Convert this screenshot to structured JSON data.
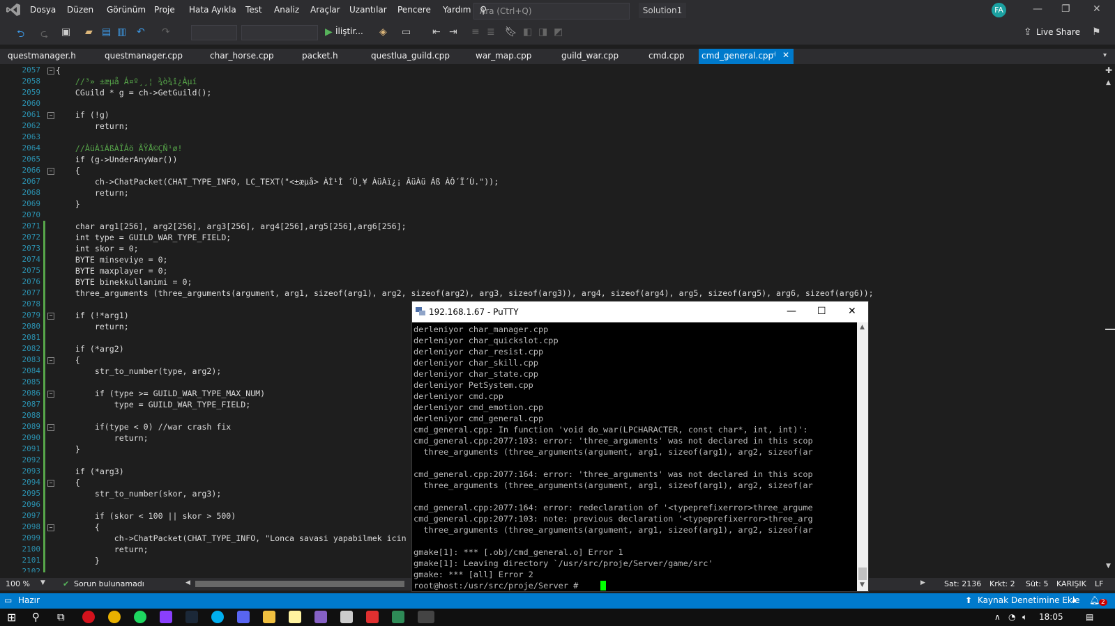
{
  "colors": {
    "accent": "#007acc",
    "editor_bg": "#1e1e1e",
    "chrome_bg": "#2d2d30"
  },
  "menu": [
    "Dosya",
    "Düzen",
    "Görünüm",
    "Proje",
    "Hata Ayıkla",
    "Test",
    "Analiz",
    "Araçlar",
    "Uzantılar",
    "Pencere",
    "Yardım"
  ],
  "search": {
    "placeholder": "Ara (Ctrl+Q)"
  },
  "solution_name": "Solution1",
  "user_initials": "FA",
  "toolbar": {
    "run_label": "İliştir...",
    "live_share": "Live Share"
  },
  "tabs": [
    "questmanager.h",
    "questmanager.cpp",
    "char_horse.cpp",
    "packet.h",
    "questlua_guild.cpp",
    "war_map.cpp",
    "guild_war.cpp",
    "cmd.cpp"
  ],
  "active_tab": "cmd_general.cpp",
  "editor": {
    "line_numbers": [
      "2057",
      "2058",
      "2059",
      "2060",
      "2061",
      "2062",
      "2063",
      "2064",
      "2065",
      "2066",
      "2067",
      "2068",
      "2069",
      "2070",
      "2071",
      "2072",
      "2073",
      "2074",
      "2075",
      "2076",
      "2077",
      "2078",
      "2079",
      "2080",
      "2081",
      "2082",
      "2083",
      "2084",
      "2085",
      "2086",
      "2087",
      "2088",
      "2089",
      "2090",
      "2091",
      "2092",
      "2093",
      "2094",
      "2095",
      "2096",
      "2097",
      "2098",
      "2099",
      "2100",
      "2101",
      "2102"
    ],
    "lines": [
      "{",
      "    //³» ±æµå Á¤º¸¸¦ ¾ò¾î¿Àµí",
      "    CGuild * g = ch->GetGuild();",
      "",
      "    if (!g)",
      "        return;",
      "",
      "    //ÀüÀïÁßÀÎÁö ÃŸÅ©ÇÑ¹ø!",
      "    if (g->UnderAnyWar())",
      "    {",
      "        ch->ChatPacket(CHAT_TYPE_INFO, LC_TEXT(\"<±æµå> ÀÌ¹Ì ´Ù¸¥ ÀüÀï¿¡ ÂüÀü Áß ÀÔ´Ï´Ù.\"));",
      "        return;",
      "    }",
      "",
      "    char arg1[256], arg2[256], arg3[256], arg4[256],arg5[256],arg6[256];",
      "    int type = GUILD_WAR_TYPE_FIELD;",
      "    int skor = 0;",
      "    BYTE minseviye = 0;",
      "    BYTE maxplayer = 0;",
      "    BYTE binekkullanimi = 0;",
      "    three_arguments (three_arguments(argument, arg1, sizeof(arg1), arg2, sizeof(arg2), arg3, sizeof(arg3)), arg4, sizeof(arg4), arg5, sizeof(arg5), arg6, sizeof(arg6));",
      "",
      "    if (!*arg1)",
      "        return;",
      "",
      "    if (*arg2)",
      "    {",
      "        str_to_number(type, arg2);",
      "",
      "        if (type >= GUILD_WAR_TYPE_MAX_NUM)",
      "            type = GUILD_WAR_TYPE_FIELD;",
      "",
      "        if(type < 0) //war crash fix",
      "            return;",
      "    }",
      "",
      "    if (*arg3)",
      "    {",
      "        str_to_number(skor, arg3);",
      "",
      "        if (skor < 100 || skor > 500)",
      "        {",
      "            ch->ChatPacket(CHAT_TYPE_INFO, \"Lonca savasi yapabilmek icin",
      "            return;",
      "        }",
      ""
    ]
  },
  "editor_status": {
    "zoom": "100 %",
    "issues": "Sorun bulunamadı",
    "line": "Sat: 2136",
    "char": "Krkt: 2",
    "col": "Süt: 5",
    "mode": "KARIŞIK",
    "eol": "LF"
  },
  "statusbar": {
    "ready": "Hazır",
    "source_control": "Kaynak Denetimine Ekle",
    "notifications": "2"
  },
  "clock": "18:05",
  "putty": {
    "title": "192.168.1.67 - PuTTY",
    "lines": [
      "derleniyor char_manager.cpp",
      "derleniyor char_quickslot.cpp",
      "derleniyor char_resist.cpp",
      "derleniyor char_skill.cpp",
      "derleniyor char_state.cpp",
      "derleniyor PetSystem.cpp",
      "derleniyor cmd.cpp",
      "derleniyor cmd_emotion.cpp",
      "derleniyor cmd_general.cpp",
      "cmd_general.cpp: In function 'void do_war(LPCHARACTER, const char*, int, int)':",
      "cmd_general.cpp:2077:103: error: 'three_arguments' was not declared in this scop",
      "  three_arguments (three_arguments(argument, arg1, sizeof(arg1), arg2, sizeof(ar",
      "",
      "cmd_general.cpp:2077:164: error: 'three_arguments' was not declared in this scop",
      "  three_arguments (three_arguments(argument, arg1, sizeof(arg1), arg2, sizeof(ar",
      "",
      "cmd_general.cpp:2077:164: error: redeclaration of '<typeprefixerror>three_argume",
      "cmd_general.cpp:2077:103: note: previous declaration '<typeprefixerror>three_arg",
      "  three_arguments (three_arguments(argument, arg1, sizeof(arg1), arg2, sizeof(ar",
      "",
      "gmake[1]: *** [.obj/cmd_general.o] Error 1",
      "gmake[1]: Leaving directory `/usr/src/proje/Server/game/src'",
      "gmake: *** [all] Error 2",
      "root@host:/usr/src/proje/Server # "
    ]
  }
}
